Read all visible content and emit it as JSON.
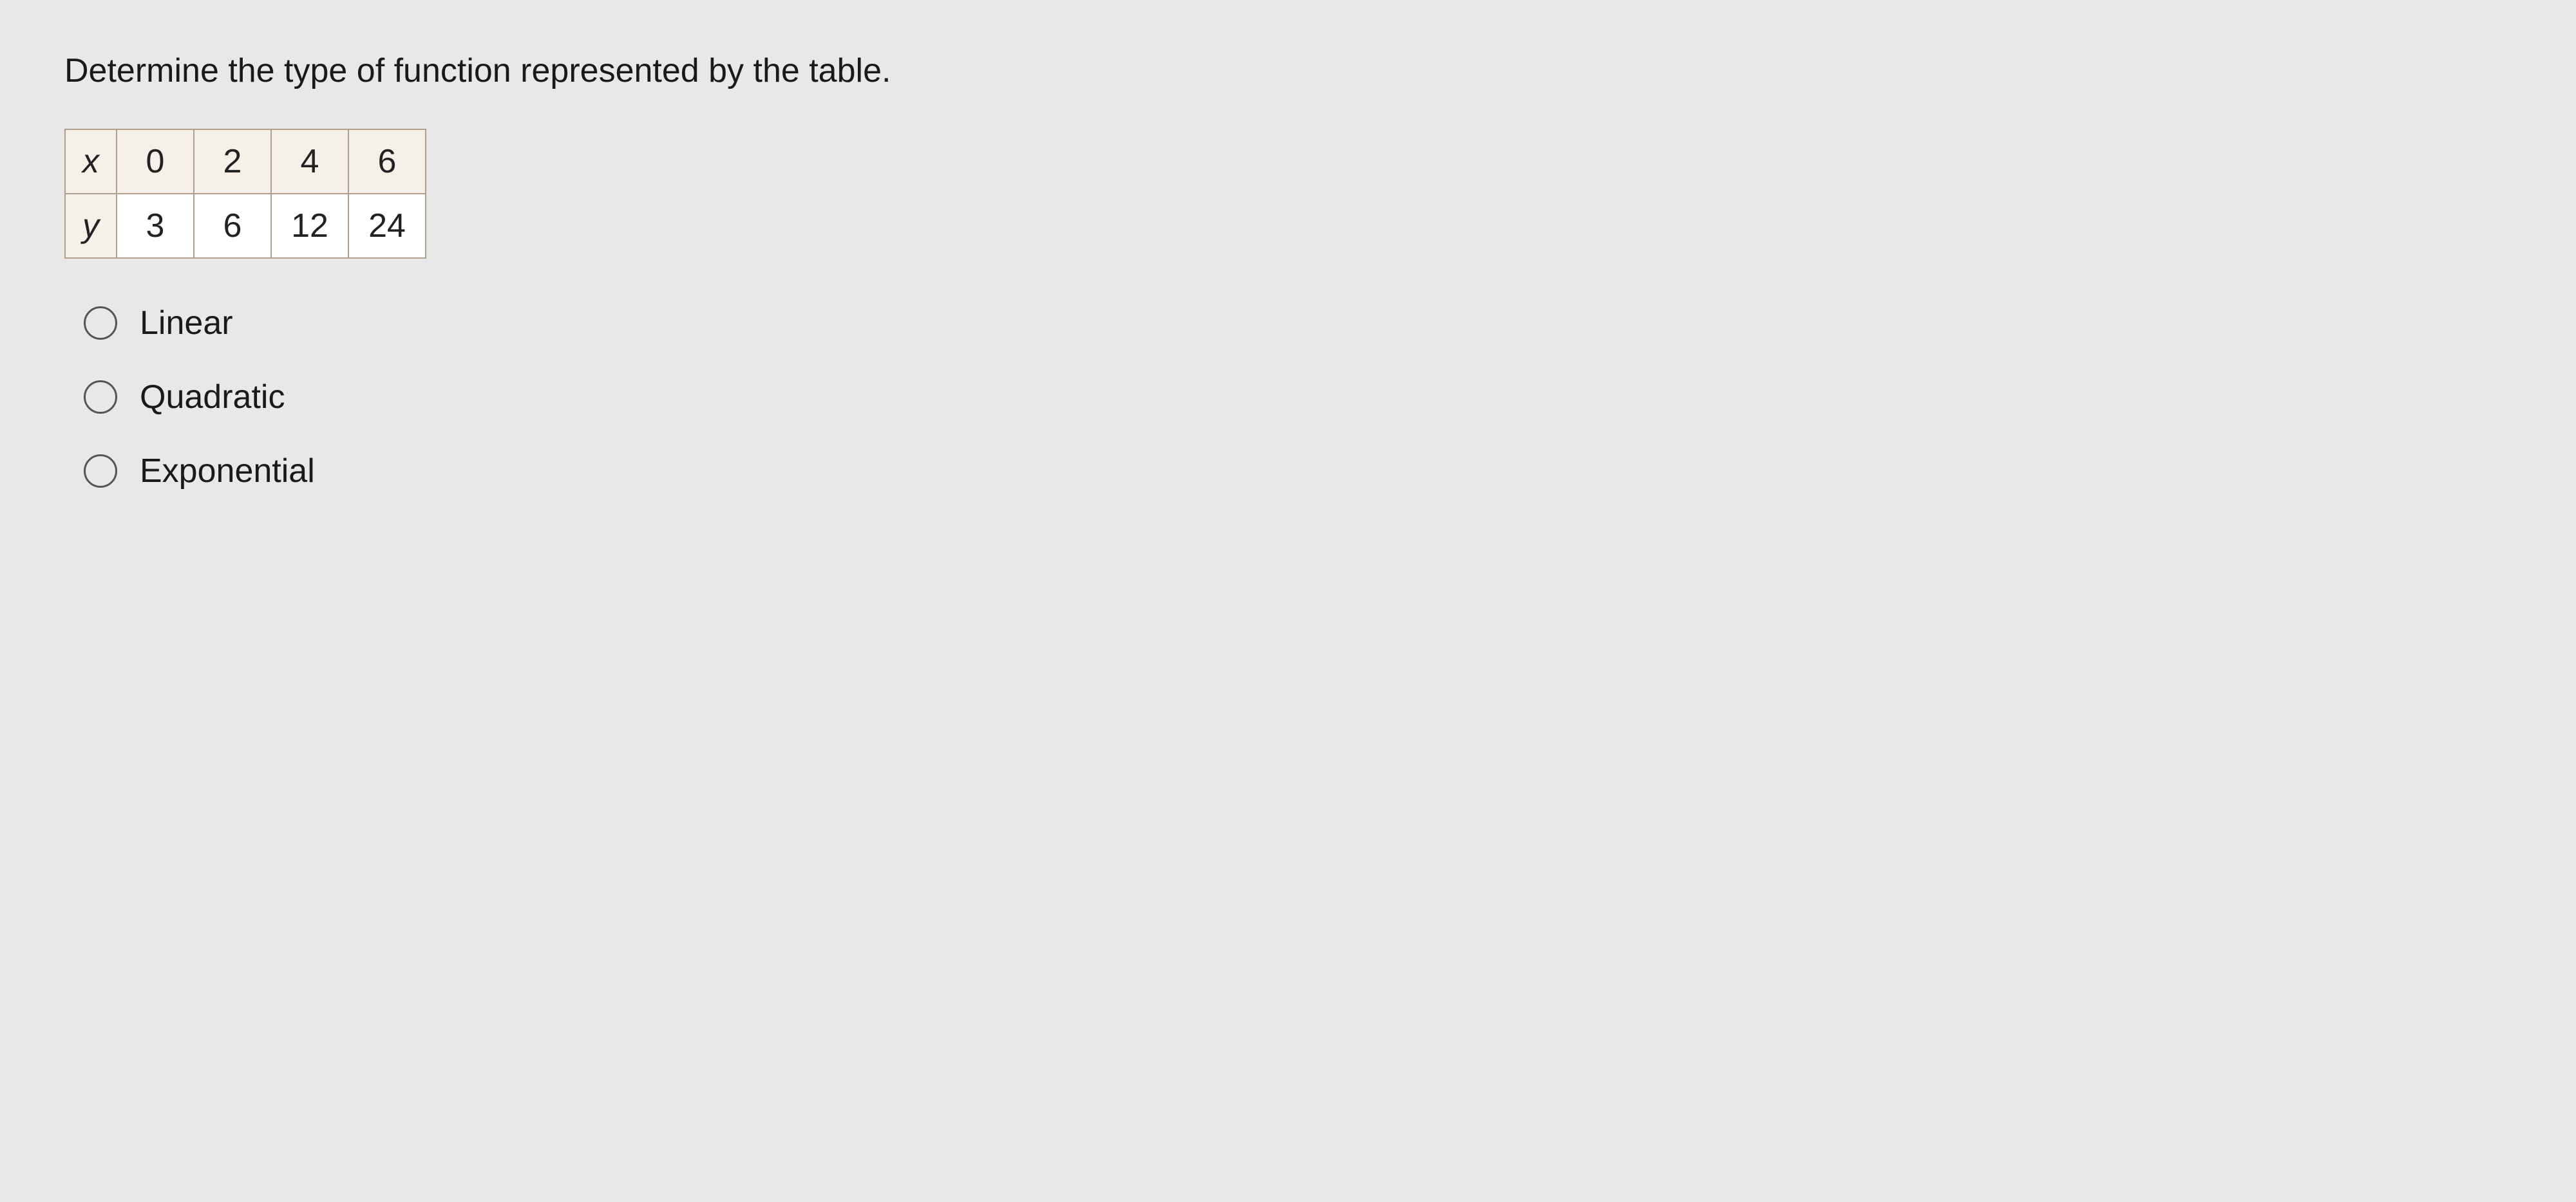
{
  "question": {
    "text": "Determine the type of function represented by the table."
  },
  "table": {
    "rows": [
      {
        "header": "x",
        "values": [
          "0",
          "2",
          "4",
          "6"
        ]
      },
      {
        "header": "y",
        "values": [
          "3",
          "6",
          "12",
          "24"
        ]
      }
    ]
  },
  "options": [
    {
      "id": "linear",
      "label": "Linear"
    },
    {
      "id": "quadratic",
      "label": "Quadratic"
    },
    {
      "id": "exponential",
      "label": "Exponential"
    }
  ]
}
